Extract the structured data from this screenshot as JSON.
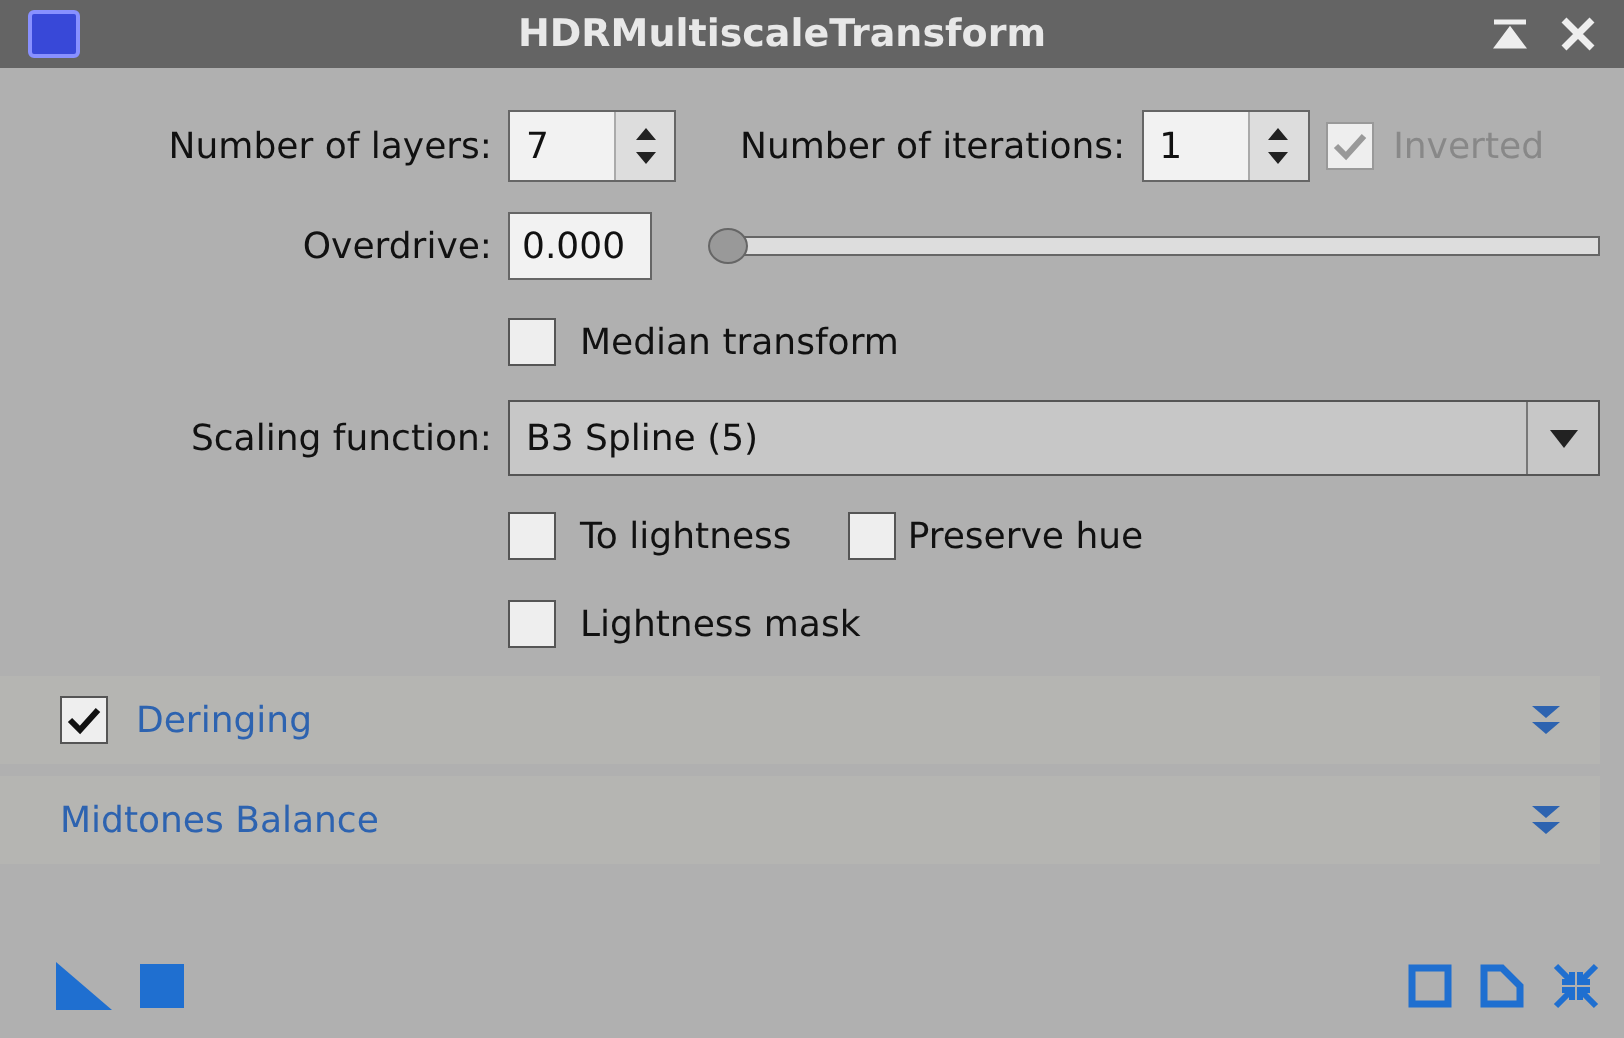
{
  "window": {
    "title": "HDRMultiscaleTransform"
  },
  "layers": {
    "label": "Number of layers:",
    "value": "7"
  },
  "iterations": {
    "label": "Number of iterations:",
    "value": "1"
  },
  "inverted": {
    "label": "Inverted",
    "checked": true,
    "disabled": true
  },
  "overdrive": {
    "label": "Overdrive:",
    "value": "0.000",
    "level": 0
  },
  "median_transform": {
    "label": "Median transform",
    "checked": false
  },
  "scaling": {
    "label": "Scaling function:",
    "value": "B3 Spline (5)"
  },
  "to_lightness": {
    "label": "To lightness",
    "checked": false
  },
  "preserve_hue": {
    "label": "Preserve hue",
    "checked": false
  },
  "lightness_mask": {
    "label": "Lightness mask",
    "checked": false
  },
  "sections": [
    {
      "title": "Deringing",
      "has_checkbox": true,
      "checked": true,
      "expanded": false
    },
    {
      "title": "Midtones Balance",
      "has_checkbox": false,
      "expanded": false
    }
  ]
}
